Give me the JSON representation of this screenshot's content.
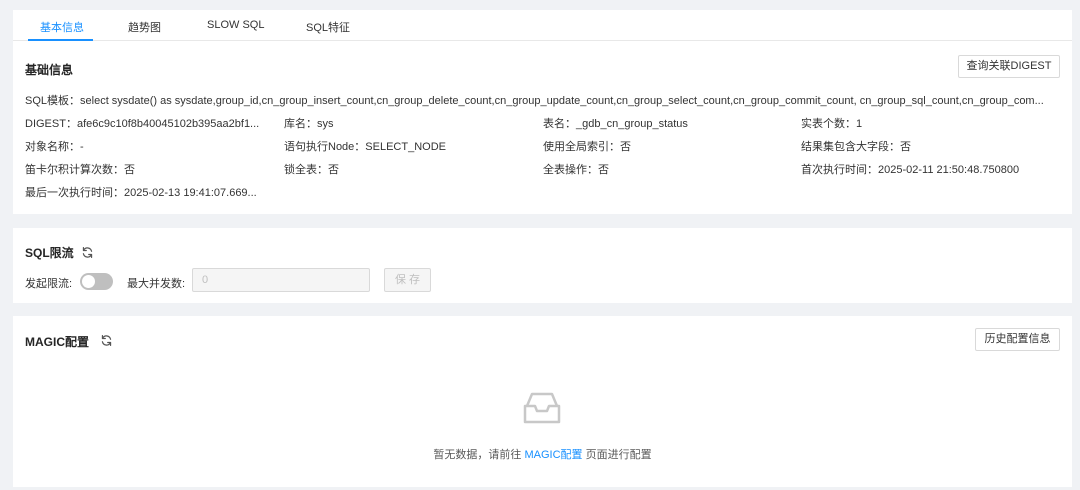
{
  "tabs": [
    {
      "label": "基本信息",
      "active": true
    },
    {
      "label": "趋势图",
      "active": false
    },
    {
      "label": "SLOW SQL",
      "active": false
    },
    {
      "label": "SQL特征",
      "active": false
    }
  ],
  "basic_info": {
    "title": "基础信息",
    "query_digest_button": "查询关联DIGEST",
    "sql_template": "SQL模板：select sysdate() as sysdate,group_id,cn_group_insert_count,cn_group_delete_count,cn_group_update_count,cn_group_select_count,cn_group_commit_count, cn_group_sql_count,cn_group_com...",
    "digest": "DIGEST：afe6c9c10f8b40045102b395aa2bf1...",
    "database": "库名：sys",
    "table_name": "表名：_gdb_cn_group_status",
    "actual_table_count": "实表个数：1",
    "object_name": "对象名称：-",
    "exec_node": "语句执行Node：SELECT_NODE",
    "global_index": "使用全局索引：否",
    "large_field": "结果集包含大字段：否",
    "cartesian": "笛卡尔积计算次数：否",
    "lock_table": "锁全表：否",
    "full_table": "全表操作：否",
    "first_exec": "首次执行时间：2025-02-11 21:50:48.750800",
    "last_exec": "最后一次执行时间：2025-02-13 19:41:07.669..."
  },
  "sql_limit": {
    "title": "SQL限流",
    "toggle_label": "发起限流:",
    "toggle_on": false,
    "max_concurrency_label": "最大并发数:",
    "max_concurrency_value": "0",
    "save_label": "保 存"
  },
  "magic": {
    "title": "MAGIC配置",
    "history_button": "历史配置信息",
    "empty_prefix": "暂无数据，请前往",
    "empty_link": "MAGIC配置",
    "empty_suffix": "页面进行配置"
  },
  "colors": {
    "accent": "#1890ff",
    "page_bg": "#f0f2f5",
    "toggle_off": "#bfbfbf"
  }
}
